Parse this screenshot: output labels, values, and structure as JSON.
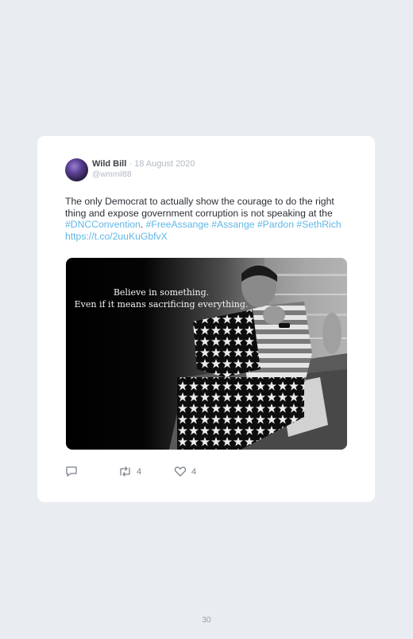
{
  "tweet": {
    "author_name": "Wild Bill",
    "date": "· 18 August 2020",
    "handle": "@wmmil88",
    "text_parts": [
      {
        "text": "The only Democrat to actually show the courage to do the right thing and expose government corruption is not speaking at the ",
        "link": false
      },
      {
        "text": "#DNCConvention",
        "link": true
      },
      {
        "text": ". ",
        "link": false
      },
      {
        "text": "#FreeAssange",
        "link": true
      },
      {
        "text": " ",
        "link": false
      },
      {
        "text": "#Assange",
        "link": true
      },
      {
        "text": " ",
        "link": false
      },
      {
        "text": "#Pardon",
        "link": true
      },
      {
        "text": " ",
        "link": false
      },
      {
        "text": "#SethRich",
        "link": true
      },
      {
        "text": " ",
        "link": false
      },
      {
        "text": "https://t.co/2uuKuGbfvX",
        "link": true
      }
    ],
    "image_caption_line1": "Believe in something.",
    "image_caption_line2": "Even if it means sacrificing everything.",
    "retweet_count": "4",
    "like_count": "4"
  },
  "page_number": "30",
  "colors": {
    "link": "#5fb7e6",
    "background": "#e9ecf0",
    "card": "#ffffff"
  },
  "icons": [
    "reply-icon",
    "retweet-icon",
    "like-icon"
  ]
}
